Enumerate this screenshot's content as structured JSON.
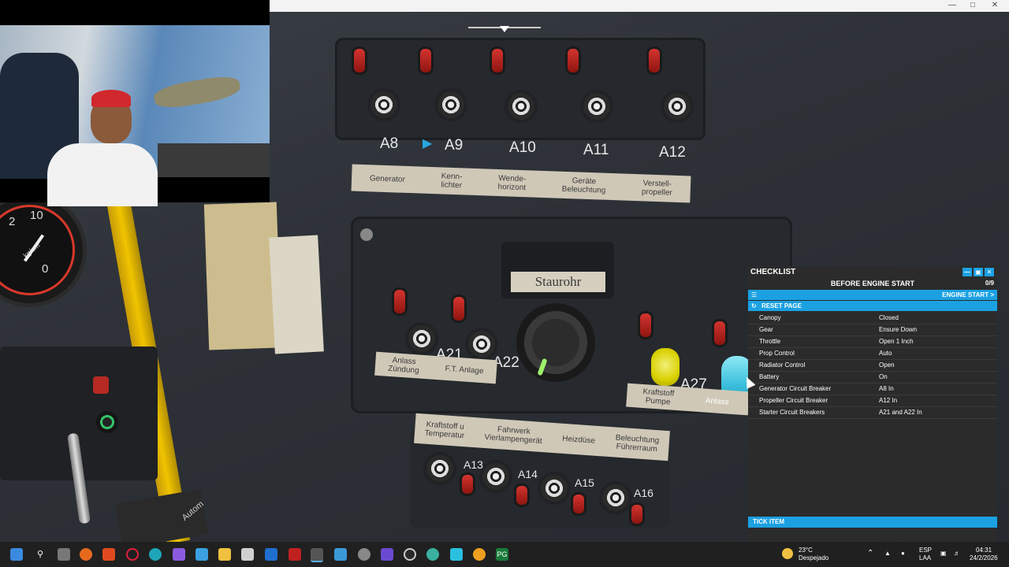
{
  "cockpit": {
    "upper_labels": [
      "A8",
      "A9",
      "A10",
      "A11",
      "A12"
    ],
    "upper_placard": [
      "Generator",
      "Kenn-\nlichter",
      "Wende-\nhorizont",
      "Geräte\nBeleuchtung",
      "Verstell-\npropeller"
    ],
    "main_labels": {
      "a21": "A21",
      "a22": "A22",
      "a27": "A27"
    },
    "main_placard": [
      "Anlass\nZündung",
      "F.T. Anlage"
    ],
    "pump_placard": "Kraftstoff\nPumpe",
    "pump_partial": "Anlass",
    "staurohr": "Staurohr",
    "lower_placard": [
      "Kraftstoff u\nTemperatur",
      "Fahrwerk\nVierlampengerät",
      "Heizdüse",
      "Beleuchtung\nFührerraum"
    ],
    "lower_labels": [
      "A13",
      "A14",
      "A15",
      "A16"
    ],
    "gauge_numbers": [
      "2",
      "10",
      "0"
    ],
    "gauge_unit": "kg/cm",
    "autom_text": "Autom"
  },
  "checklist": {
    "title": "CHECKLIST",
    "subtitle": "BEFORE ENGINE START",
    "progress": "0/9",
    "nav_label": "ENGINE START",
    "nav_chevron": ">",
    "list_icon": "list-icon",
    "reset_label": "RESET PAGE",
    "items": [
      {
        "item": "Canopy",
        "value": "Closed"
      },
      {
        "item": "Gear",
        "value": "Ensure Down"
      },
      {
        "item": "Throttle",
        "value": "Open 1 Inch"
      },
      {
        "item": "Prop Control",
        "value": "Auto"
      },
      {
        "item": "Radiator Control",
        "value": "Open"
      },
      {
        "item": "Battery",
        "value": "On"
      },
      {
        "item": "Generator Circuit Breaker",
        "value": "A8 In"
      },
      {
        "item": "Propeller Circuit Breaker",
        "value": "A12 In"
      },
      {
        "item": "Starter Circuit Breakers",
        "value": "A21 and A22 In"
      }
    ],
    "tick_label": "TICK ITEM",
    "accent": "#1ba1e2"
  },
  "taskbar": {
    "weather_temp": "23°C",
    "weather_desc": "Despejado",
    "lang_1": "ESP",
    "lang_2": "LAA",
    "time": "04:31",
    "date": "24/2/2026"
  }
}
